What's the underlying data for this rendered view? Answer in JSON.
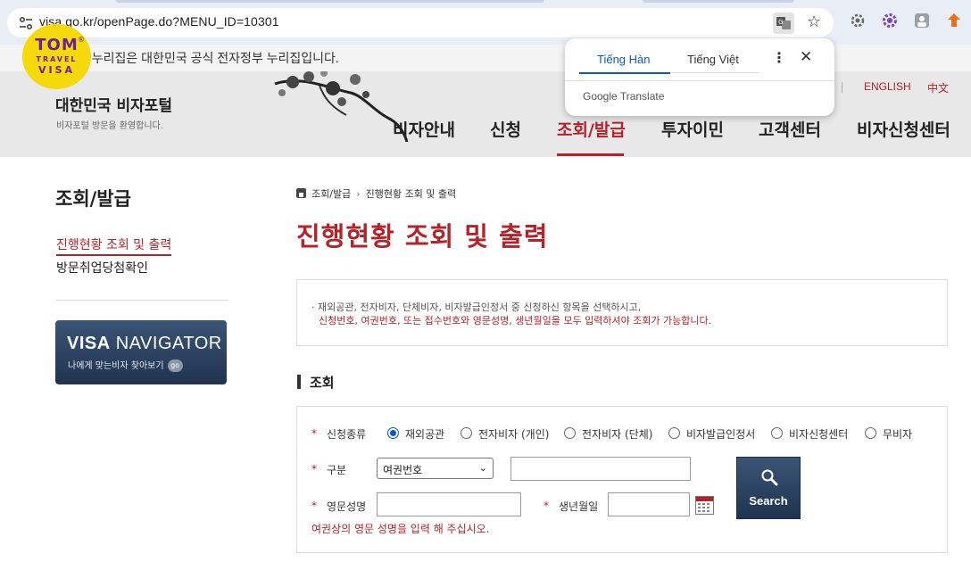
{
  "browser": {
    "url": "visa.go.kr/openPage.do?MENU_ID=10301"
  },
  "gov_notice": "이 누리집은 대한민국 공식 전자정부 누리집입니다.",
  "logo": {
    "line1": "TOM",
    "line2": "TRAVEL",
    "line3": "VISA",
    "mark": "®"
  },
  "translate_popup": {
    "tab_source": "Tiếng Hàn",
    "tab_target": "Tiếng Việt",
    "brand": "Google Translate"
  },
  "header": {
    "portal_title": "대한민국 비자포털",
    "portal_subtitle": "비자포털 방문을 환영합니다.",
    "lang_english": "ENGLISH",
    "lang_chinese": "中文",
    "nav": [
      "비자안내",
      "신청",
      "조회/발급",
      "투자이민",
      "고객센터",
      "비자신청센터"
    ]
  },
  "sidebar": {
    "title": "조회/발급",
    "items": [
      "진행현황 조회 및 출력",
      "방문취업당첨확인"
    ],
    "navigator": {
      "title_bold": "VISA",
      "title_rest": " NAVIGATOR",
      "subtitle": "나에게 맞는비자 찾아보기",
      "go": "go"
    }
  },
  "breadcrumb": [
    "조회/발급",
    "진행현황 조회 및 출력"
  ],
  "page_title": "진행현황 조회 및 출력",
  "notice": {
    "line1": "· 재외공관, 전자비자, 단체비자, 비자발급인정서 중 신청하신 항목을 선택하시고,",
    "line2": "신청번호, 여권번호, 또는 접수번호와 영문성명, 생년월일을 모두 입력하셔야 조회가 가능합니다."
  },
  "section_title": "조회",
  "form": {
    "required_mark": "*",
    "type_label": "신청종류",
    "types": [
      "재외공관",
      "전자비자 (개인)",
      "전자비자 (단체)",
      "비자발급인정서",
      "비자신청센터",
      "무비자"
    ],
    "selected_type_index": 0,
    "category_label": "구분",
    "category_value": "여권번호",
    "name_label": "영문성명",
    "birth_label": "생년월일",
    "search_label": "Search",
    "hint": "여권상의 영문 성명을 입력 해 주십시오."
  },
  "colors": {
    "accent": "#b2232a",
    "navy": "#1f3350",
    "link_blue": "#0b57d0"
  }
}
